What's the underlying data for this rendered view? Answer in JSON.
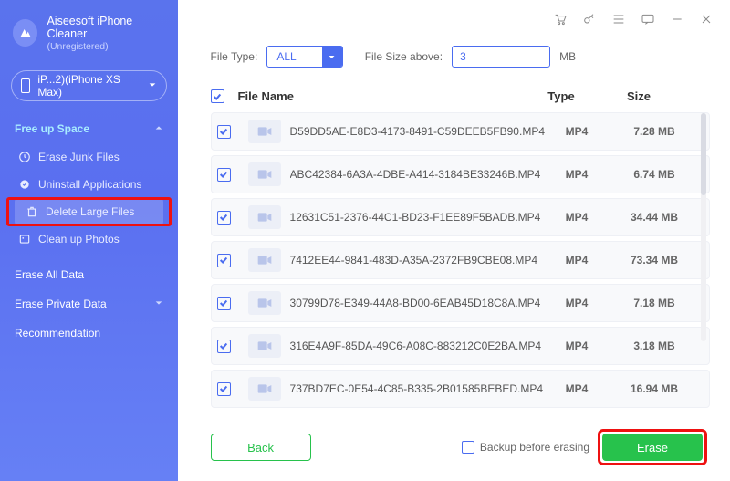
{
  "brand": {
    "title": "Aiseesoft iPhone Cleaner",
    "subtitle": "(Unregistered)"
  },
  "device": {
    "label": "iP...2)(iPhone XS Max)"
  },
  "nav": {
    "freeUp": {
      "label": "Free up Space",
      "items": [
        {
          "label": "Erase Junk Files"
        },
        {
          "label": "Uninstall Applications"
        },
        {
          "label": "Delete Large Files"
        },
        {
          "label": "Clean up Photos"
        }
      ]
    },
    "eraseAll": {
      "label": "Erase All Data"
    },
    "erasePrivate": {
      "label": "Erase Private Data"
    },
    "recommendation": {
      "label": "Recommendation"
    }
  },
  "filter": {
    "fileTypeLabel": "File Type:",
    "selectValue": "ALL",
    "fileSizeLabel": "File Size above:",
    "sizeValue": "3",
    "unit": "MB"
  },
  "columns": {
    "name": "File Name",
    "type": "Type",
    "size": "Size"
  },
  "rows": [
    {
      "name": "D59DD5AE-E8D3-4173-8491-C59DEEB5FB90.MP4",
      "type": "MP4",
      "size": "7.28 MB"
    },
    {
      "name": "ABC42384-6A3A-4DBE-A414-3184BE33246B.MP4",
      "type": "MP4",
      "size": "6.74 MB"
    },
    {
      "name": "12631C51-2376-44C1-BD23-F1EE89F5BADB.MP4",
      "type": "MP4",
      "size": "34.44 MB"
    },
    {
      "name": "7412EE44-9841-483D-A35A-2372FB9CBE08.MP4",
      "type": "MP4",
      "size": "73.34 MB"
    },
    {
      "name": "30799D78-E349-44A8-BD00-6EAB45D18C8A.MP4",
      "type": "MP4",
      "size": "7.18 MB"
    },
    {
      "name": "316E4A9F-85DA-49C6-A08C-883212C0E2BA.MP4",
      "type": "MP4",
      "size": "3.18 MB"
    },
    {
      "name": "737BD7EC-0E54-4C85-B335-2B01585BEBED.MP4",
      "type": "MP4",
      "size": "16.94 MB"
    }
  ],
  "footer": {
    "back": "Back",
    "backupLabel": "Backup before erasing",
    "erase": "Erase"
  }
}
